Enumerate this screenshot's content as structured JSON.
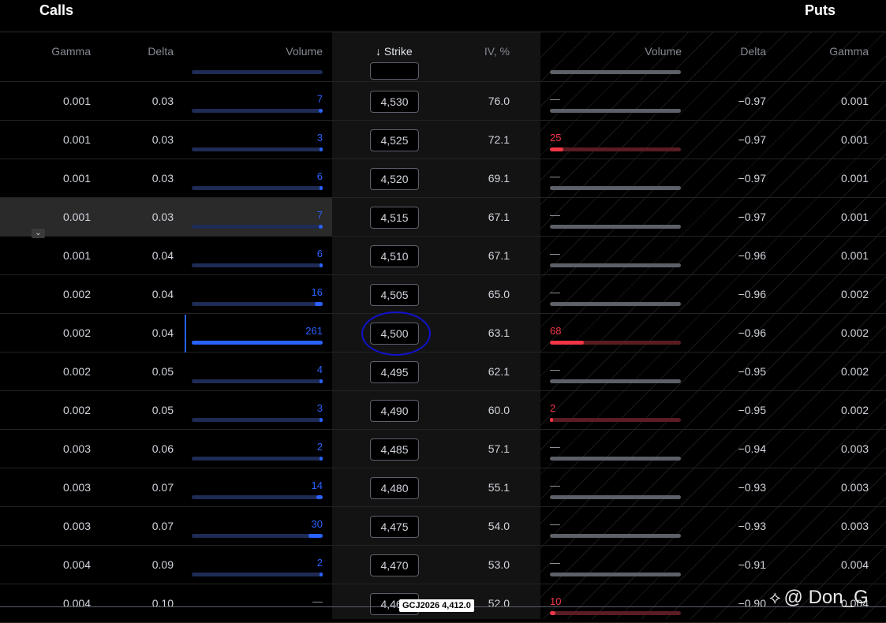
{
  "header": {
    "calls_title": "Calls",
    "puts_title": "Puts"
  },
  "columns": {
    "call_gamma": "Gamma",
    "call_delta": "Delta",
    "call_volume": "Volume",
    "strike": "↓ Strike",
    "iv": "IV, %",
    "put_volume": "Volume",
    "put_delta": "Delta",
    "put_gamma": "Gamma"
  },
  "colors": {
    "call_volume": "#2962ff",
    "put_volume": "#f23645",
    "background": "#000000"
  },
  "rows": [
    {
      "call_gamma": "0.001",
      "call_delta": "0.03",
      "call_volume": "7",
      "call_volume_frac": 0.03,
      "strike": "4,530",
      "iv": "76.0",
      "put_volume": "—",
      "put_volume_frac": 0,
      "put_delta": "−0.97",
      "put_gamma": "0.001"
    },
    {
      "call_gamma": "0.001",
      "call_delta": "0.03",
      "call_volume": "3",
      "call_volume_frac": 0.01,
      "strike": "4,525",
      "iv": "72.1",
      "put_volume": "25",
      "put_volume_frac": 0.1,
      "put_delta": "−0.97",
      "put_gamma": "0.001"
    },
    {
      "call_gamma": "0.001",
      "call_delta": "0.03",
      "call_volume": "6",
      "call_volume_frac": 0.02,
      "strike": "4,520",
      "iv": "69.1",
      "put_volume": "—",
      "put_volume_frac": 0,
      "put_delta": "−0.97",
      "put_gamma": "0.001"
    },
    {
      "call_gamma": "0.001",
      "call_delta": "0.03",
      "call_volume": "7",
      "call_volume_frac": 0.03,
      "strike": "4,515",
      "iv": "67.1",
      "put_volume": "—",
      "put_volume_frac": 0,
      "put_delta": "−0.97",
      "put_gamma": "0.001",
      "highlighted": true
    },
    {
      "call_gamma": "0.001",
      "call_delta": "0.04",
      "call_volume": "6",
      "call_volume_frac": 0.02,
      "strike": "4,510",
      "iv": "67.1",
      "put_volume": "—",
      "put_volume_frac": 0,
      "put_delta": "−0.96",
      "put_gamma": "0.001"
    },
    {
      "call_gamma": "0.002",
      "call_delta": "0.04",
      "call_volume": "16",
      "call_volume_frac": 0.06,
      "strike": "4,505",
      "iv": "65.0",
      "put_volume": "—",
      "put_volume_frac": 0,
      "put_delta": "−0.96",
      "put_gamma": "0.002"
    },
    {
      "call_gamma": "0.002",
      "call_delta": "0.04",
      "call_volume": "261",
      "call_volume_frac": 1.0,
      "strike": "4,500",
      "iv": "63.1",
      "put_volume": "68",
      "put_volume_frac": 0.26,
      "put_delta": "−0.96",
      "put_gamma": "0.002"
    },
    {
      "call_gamma": "0.002",
      "call_delta": "0.05",
      "call_volume": "4",
      "call_volume_frac": 0.015,
      "strike": "4,495",
      "iv": "62.1",
      "put_volume": "—",
      "put_volume_frac": 0,
      "put_delta": "−0.95",
      "put_gamma": "0.002"
    },
    {
      "call_gamma": "0.002",
      "call_delta": "0.05",
      "call_volume": "3",
      "call_volume_frac": 0.01,
      "strike": "4,490",
      "iv": "60.0",
      "put_volume": "2",
      "put_volume_frac": 0.01,
      "put_delta": "−0.95",
      "put_gamma": "0.002"
    },
    {
      "call_gamma": "0.003",
      "call_delta": "0.06",
      "call_volume": "2",
      "call_volume_frac": 0.008,
      "strike": "4,485",
      "iv": "57.1",
      "put_volume": "—",
      "put_volume_frac": 0,
      "put_delta": "−0.94",
      "put_gamma": "0.003"
    },
    {
      "call_gamma": "0.003",
      "call_delta": "0.07",
      "call_volume": "14",
      "call_volume_frac": 0.05,
      "strike": "4,480",
      "iv": "55.1",
      "put_volume": "—",
      "put_volume_frac": 0,
      "put_delta": "−0.93",
      "put_gamma": "0.003"
    },
    {
      "call_gamma": "0.003",
      "call_delta": "0.07",
      "call_volume": "30",
      "call_volume_frac": 0.11,
      "strike": "4,475",
      "iv": "54.0",
      "put_volume": "—",
      "put_volume_frac": 0,
      "put_delta": "−0.93",
      "put_gamma": "0.003"
    },
    {
      "call_gamma": "0.004",
      "call_delta": "0.09",
      "call_volume": "2",
      "call_volume_frac": 0.008,
      "strike": "4,470",
      "iv": "53.0",
      "put_volume": "—",
      "put_volume_frac": 0,
      "put_delta": "−0.91",
      "put_gamma": "0.004"
    },
    {
      "call_gamma": "0.004",
      "call_delta": "0.10",
      "call_volume": "—",
      "call_volume_frac": 0,
      "strike": "4,465",
      "iv": "52.0",
      "put_volume": "10",
      "put_volume_frac": 0.04,
      "put_delta": "−0.90",
      "put_gamma": "0.004"
    }
  ],
  "ticker_chip": "GCJ2026 4,412.0",
  "watermark": {
    "text": "@ Don_G",
    "icon": "binance-diamond-icon"
  }
}
